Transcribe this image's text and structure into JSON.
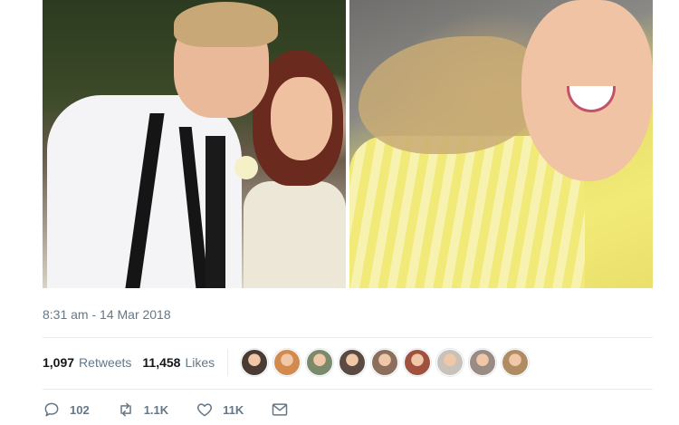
{
  "tweet": {
    "timestamp": "8:31 am - 14 Mar 2018",
    "retweets": {
      "count": "1,097",
      "label": "Retweets"
    },
    "likes": {
      "count": "11,458",
      "label": "Likes"
    },
    "liker_avatars": [
      {
        "color": "#4a3b35"
      },
      {
        "color": "#d28a4e"
      },
      {
        "color": "#7a8a6a"
      },
      {
        "color": "#5b4a42"
      },
      {
        "color": "#8c6e5c"
      },
      {
        "color": "#a0523e"
      },
      {
        "color": "#c9c2bb"
      },
      {
        "color": "#9a8c84"
      },
      {
        "color": "#b08c62"
      }
    ],
    "actions": {
      "reply": {
        "icon": "reply-icon",
        "count": "102"
      },
      "retweet": {
        "icon": "retweet-icon",
        "count": "1.1K"
      },
      "like": {
        "icon": "heart-icon",
        "count": "11K"
      },
      "message": {
        "icon": "envelope-icon"
      }
    }
  },
  "colors": {
    "secondary_text": "#657786",
    "divider": "#e6ecf0"
  }
}
